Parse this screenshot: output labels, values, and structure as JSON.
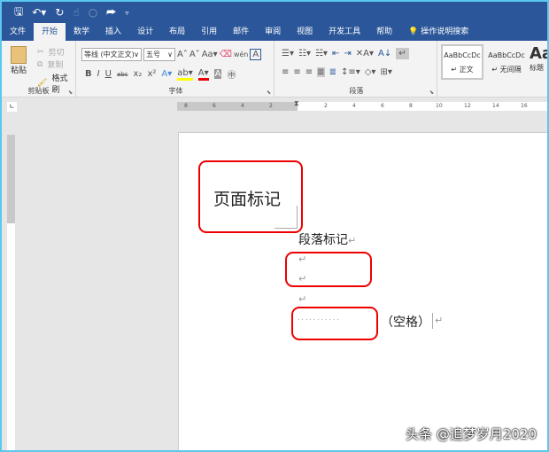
{
  "qat": {
    "icons": [
      "save-icon",
      "undo-icon",
      "redo-icon",
      "touch-mode-icon",
      "circle-icon",
      "customize-icon",
      "dropdown-icon"
    ]
  },
  "tabs": [
    "文件",
    "开始",
    "数学",
    "插入",
    "设计",
    "布局",
    "引用",
    "邮件",
    "审阅",
    "视图",
    "开发工具",
    "帮助"
  ],
  "active_tab": "开始",
  "tell_me": "操作说明搜索",
  "clipboard": {
    "paste": "粘贴",
    "cut": "剪切",
    "copy": "复制",
    "format_painter": "格式刷",
    "label": "剪贴板"
  },
  "font": {
    "name": "等线 (中文正文)",
    "size": "五号",
    "case": "Aa",
    "bold": "B",
    "italic": "I",
    "underline": "U",
    "strike": "abc",
    "sub": "x₂",
    "sup": "x²",
    "label": "字体",
    "colors": {
      "highlight": "#ffff00",
      "font_color": "#e00000"
    }
  },
  "paragraph": {
    "label": "段落"
  },
  "styles": [
    {
      "preview": "AaBbCcDc",
      "name": "↵ 正文"
    },
    {
      "preview": "AaBbCcDc",
      "name": "↵ 无间隔"
    },
    {
      "preview": "Aa",
      "name": "标题"
    }
  ],
  "ruler": {
    "left": [
      "8",
      "6",
      "4",
      "2"
    ],
    "right": [
      "2",
      "4",
      "6",
      "8",
      "10",
      "12",
      "14",
      "16"
    ]
  },
  "document": {
    "page_mark_label": "页面标记",
    "paragraph_mark_label": "段落标记",
    "para_mark": "↵",
    "spaces": "· · · · · · · · · · ·",
    "space_label": "（空格）"
  },
  "watermark": "头条 @追梦岁月2020",
  "accent": "#2b579a",
  "highlight_box": "#e00000"
}
